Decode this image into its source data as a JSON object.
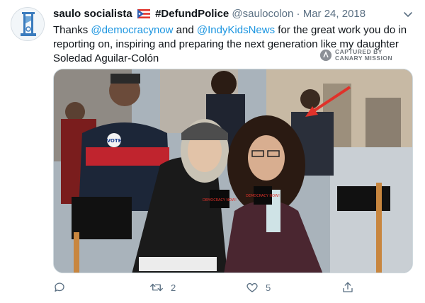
{
  "tweet": {
    "display_name": "saulo socialista",
    "hashtag": "#DefundPolice",
    "handle": "@saulocolon",
    "separator": "·",
    "date": "Mar 24, 2018",
    "text_1": "Thanks ",
    "mention_1": "@democracynow",
    "text_2": " and ",
    "mention_2": "@IndyKidsNews",
    "text_3": " for the great work you do in reporting on, inspiring and preparing the next generation like my daughter Soledad Aguilar-Colón"
  },
  "watermark": {
    "line_1": "CAPTURED BY",
    "line_2": "CANARY MISSION"
  },
  "actions": {
    "reply_count": "",
    "retweet_count": "2",
    "like_count": "5"
  },
  "media": {
    "sign_text": "VOTE",
    "mic_label": "DEMOCRACY NOW!"
  },
  "colors": {
    "mention": "#1b95e0",
    "muted": "#5b7083",
    "arrow": "#e0322a"
  }
}
